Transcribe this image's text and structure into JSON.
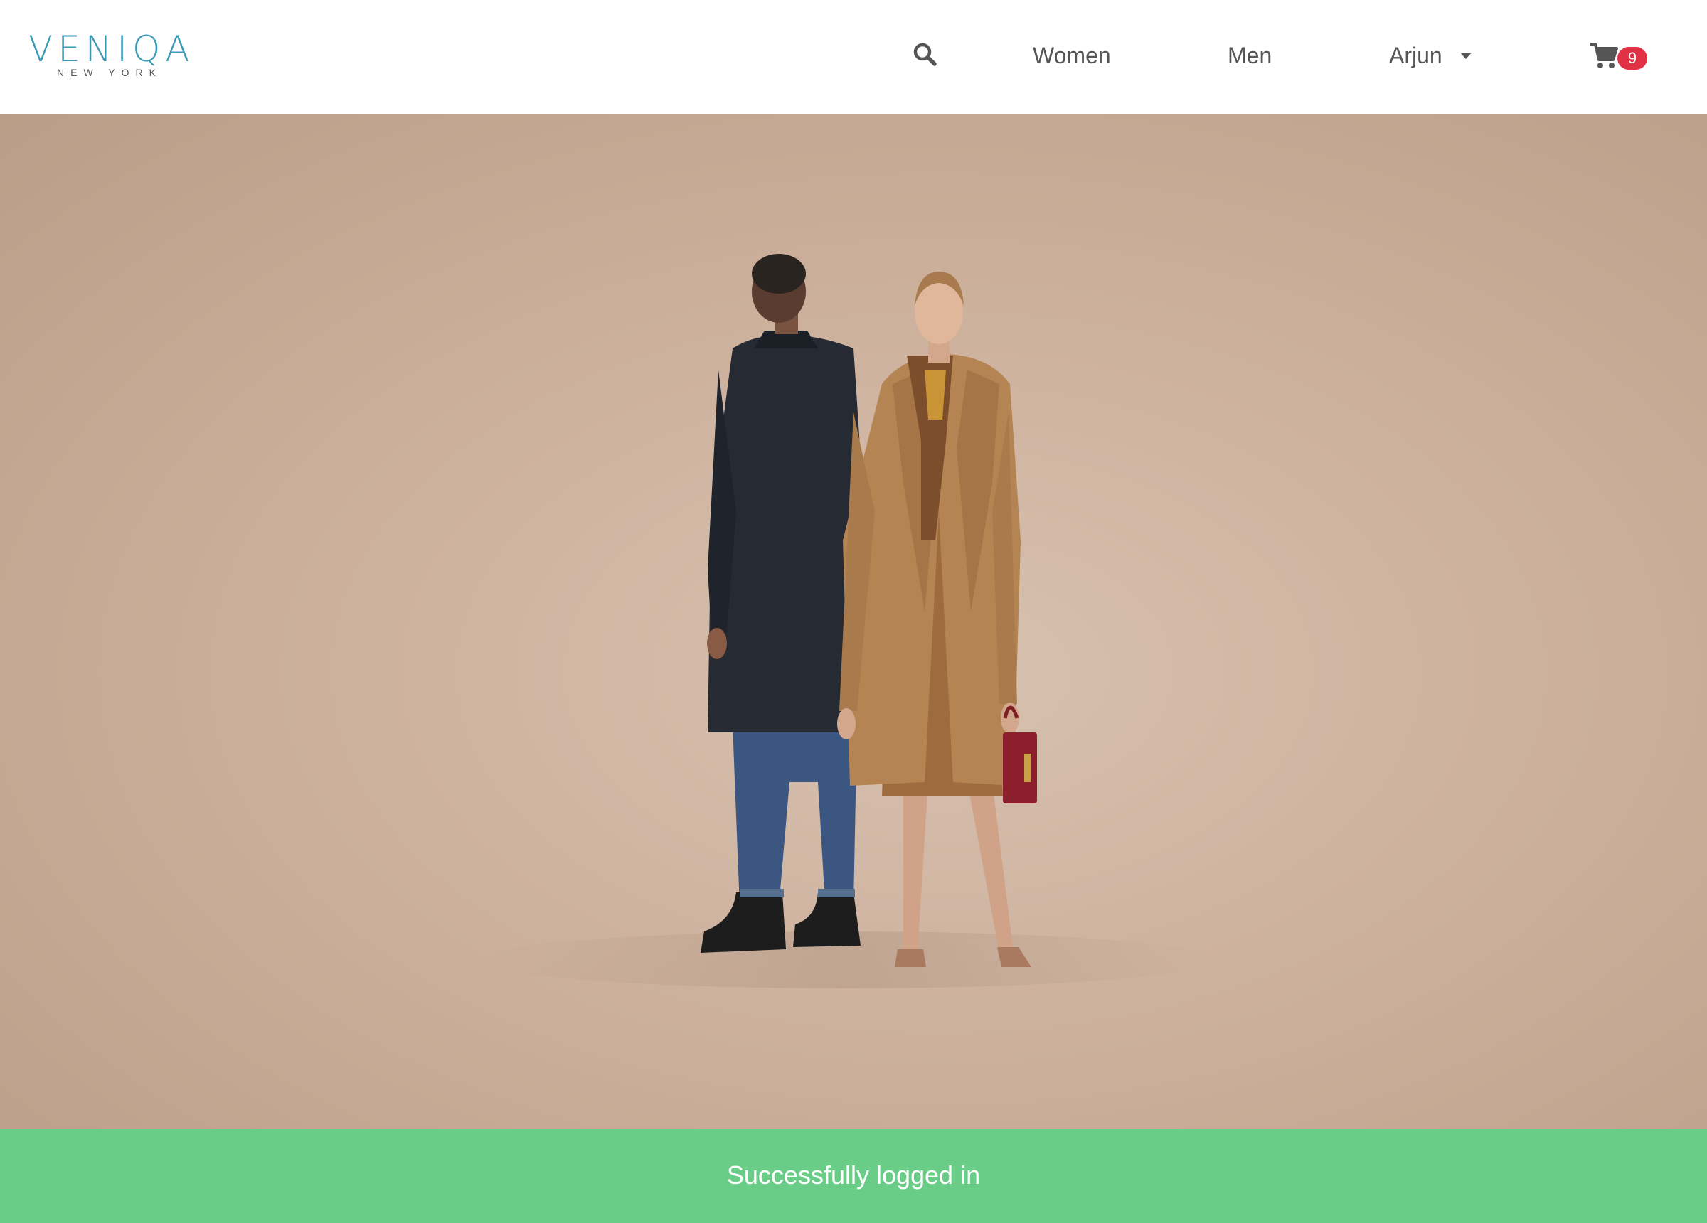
{
  "brand": {
    "name": "VENIQA",
    "subtitle": "NEW YORK",
    "color": "#3a9ab6"
  },
  "nav": {
    "search_icon": "search-icon",
    "links": [
      {
        "label": "Women"
      },
      {
        "label": "Men"
      }
    ],
    "user": {
      "label": "Arjun",
      "dropdown_icon": "caret-down-icon"
    },
    "cart": {
      "icon": "shopping-cart-icon",
      "count": "9",
      "badge_color": "#e03244"
    }
  },
  "hero": {
    "background_color": "#c9ac98"
  },
  "toast": {
    "message": "Successfully logged in",
    "color": "#6acd87"
  }
}
